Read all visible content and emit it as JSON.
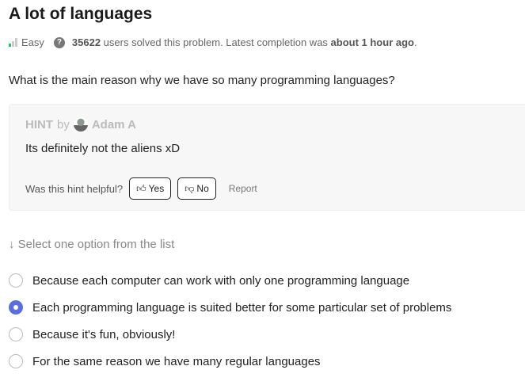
{
  "title": "A lot of languages",
  "meta": {
    "difficulty": "Easy",
    "solved_count": "35622",
    "solved_text": " users solved this problem. Latest completion was ",
    "latest": "about 1 hour ago",
    "end": "."
  },
  "question": "What is the main reason why we have so many programming languages?",
  "hint": {
    "label": "HINT",
    "by": "by",
    "author": "Adam A",
    "text": "Its definitely not the aliens xD",
    "helpful": "Was this hint helpful?",
    "yes": "Yes",
    "no": "No",
    "report": "Report"
  },
  "select_hint": "Select one option from the list",
  "options": [
    {
      "label": "Because each computer can work with only one programming language",
      "selected": false
    },
    {
      "label": "Each programming language is suited better for some particular set of problems",
      "selected": true
    },
    {
      "label": "Because it's fun, obviously!",
      "selected": false
    },
    {
      "label": "For the same reason we have many regular languages",
      "selected": false
    }
  ],
  "colors": {
    "accent": "#5b6ee1",
    "easy": "#2bbf6b"
  }
}
